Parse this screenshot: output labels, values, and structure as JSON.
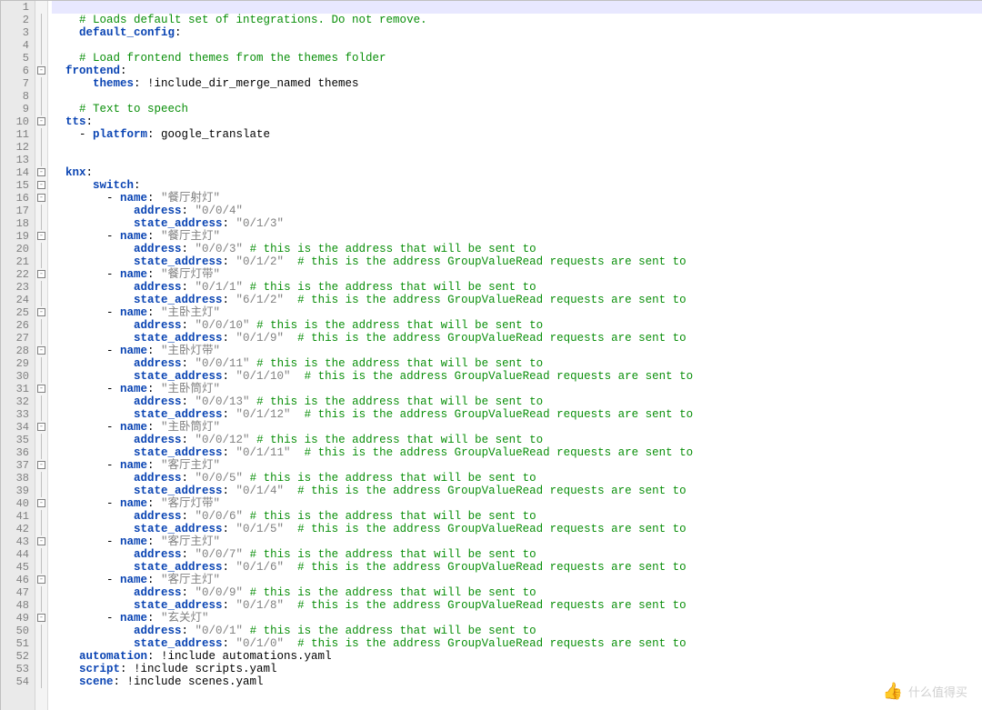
{
  "watermark": "什么值得买",
  "comment_send": "# this is the address that will be sent to",
  "comment_read": "# this is the address GroupValueRead requests are sent to",
  "lines": [
    {
      "n": 1,
      "fold": "",
      "hl": true,
      "parts": []
    },
    {
      "n": 2,
      "fold": "line",
      "parts": [
        {
          "cls": "com",
          "pad": 4,
          "t": "# Loads default set of integrations. Do not remove."
        }
      ]
    },
    {
      "n": 3,
      "fold": "line",
      "parts": [
        {
          "cls": "kw",
          "pad": 4,
          "t": "default_config"
        },
        {
          "cls": "plain",
          "t": ":"
        }
      ]
    },
    {
      "n": 4,
      "fold": "line",
      "parts": []
    },
    {
      "n": 5,
      "fold": "line",
      "parts": [
        {
          "cls": "com",
          "pad": 4,
          "t": "# Load frontend themes from the themes folder"
        }
      ]
    },
    {
      "n": 6,
      "fold": "box",
      "parts": [
        {
          "cls": "kw",
          "pad": 2,
          "t": "frontend"
        },
        {
          "cls": "plain",
          "t": ":"
        }
      ]
    },
    {
      "n": 7,
      "fold": "line",
      "parts": [
        {
          "cls": "kw",
          "pad": 6,
          "t": "themes"
        },
        {
          "cls": "plain",
          "t": ": !include_dir_merge_named themes"
        }
      ]
    },
    {
      "n": 8,
      "fold": "line",
      "parts": []
    },
    {
      "n": 9,
      "fold": "line",
      "parts": [
        {
          "cls": "com",
          "pad": 4,
          "t": "# Text to speech"
        }
      ]
    },
    {
      "n": 10,
      "fold": "box",
      "parts": [
        {
          "cls": "kw",
          "pad": 2,
          "t": "tts"
        },
        {
          "cls": "plain",
          "t": ":"
        }
      ]
    },
    {
      "n": 11,
      "fold": "line",
      "parts": [
        {
          "cls": "plain",
          "pad": 4,
          "t": "- "
        },
        {
          "cls": "kw",
          "t": "platform"
        },
        {
          "cls": "plain",
          "t": ": google_translate"
        }
      ]
    },
    {
      "n": 12,
      "fold": "line",
      "parts": []
    },
    {
      "n": 13,
      "fold": "line",
      "parts": []
    },
    {
      "n": 14,
      "fold": "box",
      "parts": [
        {
          "cls": "kw",
          "pad": 2,
          "t": "knx"
        },
        {
          "cls": "plain",
          "t": ":"
        }
      ]
    },
    {
      "n": 15,
      "fold": "box",
      "parts": [
        {
          "cls": "kw",
          "pad": 6,
          "t": "switch"
        },
        {
          "cls": "plain",
          "t": ":"
        }
      ]
    },
    {
      "n": 16,
      "fold": "box",
      "parts": [
        {
          "cls": "plain",
          "pad": 8,
          "t": "- "
        },
        {
          "cls": "kw",
          "t": "name"
        },
        {
          "cls": "plain",
          "t": ": "
        },
        {
          "cls": "str",
          "t": "\"餐厅射灯\""
        }
      ]
    },
    {
      "n": 17,
      "fold": "line",
      "parts": [
        {
          "cls": "kw",
          "pad": 12,
          "t": "address"
        },
        {
          "cls": "plain",
          "t": ": "
        },
        {
          "cls": "str",
          "t": "\"0/0/4\""
        }
      ]
    },
    {
      "n": 18,
      "fold": "line",
      "parts": [
        {
          "cls": "kw",
          "pad": 12,
          "t": "state_address"
        },
        {
          "cls": "plain",
          "t": ": "
        },
        {
          "cls": "str",
          "t": "\"0/1/3\""
        }
      ]
    },
    {
      "n": 19,
      "fold": "box",
      "parts": [
        {
          "cls": "plain",
          "pad": 8,
          "t": "- "
        },
        {
          "cls": "kw",
          "t": "name"
        },
        {
          "cls": "plain",
          "t": ": "
        },
        {
          "cls": "str",
          "t": "\"餐厅主灯\""
        }
      ]
    },
    {
      "n": 20,
      "fold": "line",
      "parts": [
        {
          "cls": "kw",
          "pad": 12,
          "t": "address"
        },
        {
          "cls": "plain",
          "t": ": "
        },
        {
          "cls": "str",
          "t": "\"0/0/3\""
        },
        {
          "cls": "plain",
          "t": " "
        },
        {
          "cls": "com",
          "ref": "comment_send"
        }
      ]
    },
    {
      "n": 21,
      "fold": "line",
      "parts": [
        {
          "cls": "kw",
          "pad": 12,
          "t": "state_address"
        },
        {
          "cls": "plain",
          "t": ": "
        },
        {
          "cls": "str",
          "t": "\"0/1/2\""
        },
        {
          "cls": "plain",
          "t": "  "
        },
        {
          "cls": "com",
          "ref": "comment_read"
        }
      ]
    },
    {
      "n": 22,
      "fold": "box",
      "parts": [
        {
          "cls": "plain",
          "pad": 8,
          "t": "- "
        },
        {
          "cls": "kw",
          "t": "name"
        },
        {
          "cls": "plain",
          "t": ": "
        },
        {
          "cls": "str",
          "t": "\"餐厅灯带\""
        }
      ]
    },
    {
      "n": 23,
      "fold": "line",
      "parts": [
        {
          "cls": "kw",
          "pad": 12,
          "t": "address"
        },
        {
          "cls": "plain",
          "t": ": "
        },
        {
          "cls": "str",
          "t": "\"0/1/1\""
        },
        {
          "cls": "plain",
          "t": " "
        },
        {
          "cls": "com",
          "ref": "comment_send"
        }
      ]
    },
    {
      "n": 24,
      "fold": "line",
      "parts": [
        {
          "cls": "kw",
          "pad": 12,
          "t": "state_address"
        },
        {
          "cls": "plain",
          "t": ": "
        },
        {
          "cls": "str",
          "t": "\"6/1/2\""
        },
        {
          "cls": "plain",
          "t": "  "
        },
        {
          "cls": "com",
          "ref": "comment_read"
        }
      ]
    },
    {
      "n": 25,
      "fold": "box",
      "parts": [
        {
          "cls": "plain",
          "pad": 8,
          "t": "- "
        },
        {
          "cls": "kw",
          "t": "name"
        },
        {
          "cls": "plain",
          "t": ": "
        },
        {
          "cls": "str",
          "t": "\"主卧主灯\""
        }
      ]
    },
    {
      "n": 26,
      "fold": "line",
      "parts": [
        {
          "cls": "kw",
          "pad": 12,
          "t": "address"
        },
        {
          "cls": "plain",
          "t": ": "
        },
        {
          "cls": "str",
          "t": "\"0/0/10\""
        },
        {
          "cls": "plain",
          "t": " "
        },
        {
          "cls": "com",
          "ref": "comment_send"
        }
      ]
    },
    {
      "n": 27,
      "fold": "line",
      "parts": [
        {
          "cls": "kw",
          "pad": 12,
          "t": "state_address"
        },
        {
          "cls": "plain",
          "t": ": "
        },
        {
          "cls": "str",
          "t": "\"0/1/9\""
        },
        {
          "cls": "plain",
          "t": "  "
        },
        {
          "cls": "com",
          "ref": "comment_read"
        }
      ]
    },
    {
      "n": 28,
      "fold": "box",
      "parts": [
        {
          "cls": "plain",
          "pad": 8,
          "t": "- "
        },
        {
          "cls": "kw",
          "t": "name"
        },
        {
          "cls": "plain",
          "t": ": "
        },
        {
          "cls": "str",
          "t": "\"主卧灯带\""
        }
      ]
    },
    {
      "n": 29,
      "fold": "line",
      "parts": [
        {
          "cls": "kw",
          "pad": 12,
          "t": "address"
        },
        {
          "cls": "plain",
          "t": ": "
        },
        {
          "cls": "str",
          "t": "\"0/0/11\""
        },
        {
          "cls": "plain",
          "t": " "
        },
        {
          "cls": "com",
          "ref": "comment_send"
        }
      ]
    },
    {
      "n": 30,
      "fold": "line",
      "parts": [
        {
          "cls": "kw",
          "pad": 12,
          "t": "state_address"
        },
        {
          "cls": "plain",
          "t": ": "
        },
        {
          "cls": "str",
          "t": "\"0/1/10\""
        },
        {
          "cls": "plain",
          "t": "  "
        },
        {
          "cls": "com",
          "ref": "comment_read"
        }
      ]
    },
    {
      "n": 31,
      "fold": "box",
      "parts": [
        {
          "cls": "plain",
          "pad": 8,
          "t": "- "
        },
        {
          "cls": "kw",
          "t": "name"
        },
        {
          "cls": "plain",
          "t": ": "
        },
        {
          "cls": "str",
          "t": "\"主卧筒灯\""
        }
      ]
    },
    {
      "n": 32,
      "fold": "line",
      "parts": [
        {
          "cls": "kw",
          "pad": 12,
          "t": "address"
        },
        {
          "cls": "plain",
          "t": ": "
        },
        {
          "cls": "str",
          "t": "\"0/0/13\""
        },
        {
          "cls": "plain",
          "t": " "
        },
        {
          "cls": "com",
          "ref": "comment_send"
        }
      ]
    },
    {
      "n": 33,
      "fold": "line",
      "parts": [
        {
          "cls": "kw",
          "pad": 12,
          "t": "state_address"
        },
        {
          "cls": "plain",
          "t": ": "
        },
        {
          "cls": "str",
          "t": "\"0/1/12\""
        },
        {
          "cls": "plain",
          "t": "  "
        },
        {
          "cls": "com",
          "ref": "comment_read"
        }
      ]
    },
    {
      "n": 34,
      "fold": "box",
      "parts": [
        {
          "cls": "plain",
          "pad": 8,
          "t": "- "
        },
        {
          "cls": "kw",
          "t": "name"
        },
        {
          "cls": "plain",
          "t": ": "
        },
        {
          "cls": "str",
          "t": "\"主卧筒灯\""
        }
      ]
    },
    {
      "n": 35,
      "fold": "line",
      "parts": [
        {
          "cls": "kw",
          "pad": 12,
          "t": "address"
        },
        {
          "cls": "plain",
          "t": ": "
        },
        {
          "cls": "str",
          "t": "\"0/0/12\""
        },
        {
          "cls": "plain",
          "t": " "
        },
        {
          "cls": "com",
          "ref": "comment_send"
        }
      ]
    },
    {
      "n": 36,
      "fold": "line",
      "parts": [
        {
          "cls": "kw",
          "pad": 12,
          "t": "state_address"
        },
        {
          "cls": "plain",
          "t": ": "
        },
        {
          "cls": "str",
          "t": "\"0/1/11\""
        },
        {
          "cls": "plain",
          "t": "  "
        },
        {
          "cls": "com",
          "ref": "comment_read"
        }
      ]
    },
    {
      "n": 37,
      "fold": "box",
      "parts": [
        {
          "cls": "plain",
          "pad": 8,
          "t": "- "
        },
        {
          "cls": "kw",
          "t": "name"
        },
        {
          "cls": "plain",
          "t": ": "
        },
        {
          "cls": "str",
          "t": "\"客厅主灯\""
        }
      ]
    },
    {
      "n": 38,
      "fold": "line",
      "parts": [
        {
          "cls": "kw",
          "pad": 12,
          "t": "address"
        },
        {
          "cls": "plain",
          "t": ": "
        },
        {
          "cls": "str",
          "t": "\"0/0/5\""
        },
        {
          "cls": "plain",
          "t": " "
        },
        {
          "cls": "com",
          "ref": "comment_send"
        }
      ]
    },
    {
      "n": 39,
      "fold": "line",
      "parts": [
        {
          "cls": "kw",
          "pad": 12,
          "t": "state_address"
        },
        {
          "cls": "plain",
          "t": ": "
        },
        {
          "cls": "str",
          "t": "\"0/1/4\""
        },
        {
          "cls": "plain",
          "t": "  "
        },
        {
          "cls": "com",
          "ref": "comment_read"
        }
      ]
    },
    {
      "n": 40,
      "fold": "box",
      "parts": [
        {
          "cls": "plain",
          "pad": 8,
          "t": "- "
        },
        {
          "cls": "kw",
          "t": "name"
        },
        {
          "cls": "plain",
          "t": ": "
        },
        {
          "cls": "str",
          "t": "\"客厅灯带\""
        }
      ]
    },
    {
      "n": 41,
      "fold": "line",
      "parts": [
        {
          "cls": "kw",
          "pad": 12,
          "t": "address"
        },
        {
          "cls": "plain",
          "t": ": "
        },
        {
          "cls": "str",
          "t": "\"0/0/6\""
        },
        {
          "cls": "plain",
          "t": " "
        },
        {
          "cls": "com",
          "ref": "comment_send"
        }
      ]
    },
    {
      "n": 42,
      "fold": "line",
      "parts": [
        {
          "cls": "kw",
          "pad": 12,
          "t": "state_address"
        },
        {
          "cls": "plain",
          "t": ": "
        },
        {
          "cls": "str",
          "t": "\"0/1/5\""
        },
        {
          "cls": "plain",
          "t": "  "
        },
        {
          "cls": "com",
          "ref": "comment_read"
        }
      ]
    },
    {
      "n": 43,
      "fold": "box",
      "parts": [
        {
          "cls": "plain",
          "pad": 8,
          "t": "- "
        },
        {
          "cls": "kw",
          "t": "name"
        },
        {
          "cls": "plain",
          "t": ": "
        },
        {
          "cls": "str",
          "t": "\"客厅主灯\""
        }
      ]
    },
    {
      "n": 44,
      "fold": "line",
      "parts": [
        {
          "cls": "kw",
          "pad": 12,
          "t": "address"
        },
        {
          "cls": "plain",
          "t": ": "
        },
        {
          "cls": "str",
          "t": "\"0/0/7\""
        },
        {
          "cls": "plain",
          "t": " "
        },
        {
          "cls": "com",
          "ref": "comment_send"
        }
      ]
    },
    {
      "n": 45,
      "fold": "line",
      "parts": [
        {
          "cls": "kw",
          "pad": 12,
          "t": "state_address"
        },
        {
          "cls": "plain",
          "t": ": "
        },
        {
          "cls": "str",
          "t": "\"0/1/6\""
        },
        {
          "cls": "plain",
          "t": "  "
        },
        {
          "cls": "com",
          "ref": "comment_read"
        }
      ]
    },
    {
      "n": 46,
      "fold": "box",
      "parts": [
        {
          "cls": "plain",
          "pad": 8,
          "t": "- "
        },
        {
          "cls": "kw",
          "t": "name"
        },
        {
          "cls": "plain",
          "t": ": "
        },
        {
          "cls": "str",
          "t": "\"客厅主灯\""
        }
      ]
    },
    {
      "n": 47,
      "fold": "line",
      "parts": [
        {
          "cls": "kw",
          "pad": 12,
          "t": "address"
        },
        {
          "cls": "plain",
          "t": ": "
        },
        {
          "cls": "str",
          "t": "\"0/0/9\""
        },
        {
          "cls": "plain",
          "t": " "
        },
        {
          "cls": "com",
          "ref": "comment_send"
        }
      ]
    },
    {
      "n": 48,
      "fold": "line",
      "parts": [
        {
          "cls": "kw",
          "pad": 12,
          "t": "state_address"
        },
        {
          "cls": "plain",
          "t": ": "
        },
        {
          "cls": "str",
          "t": "\"0/1/8\""
        },
        {
          "cls": "plain",
          "t": "  "
        },
        {
          "cls": "com",
          "ref": "comment_read"
        }
      ]
    },
    {
      "n": 49,
      "fold": "box",
      "parts": [
        {
          "cls": "plain",
          "pad": 8,
          "t": "- "
        },
        {
          "cls": "kw",
          "t": "name"
        },
        {
          "cls": "plain",
          "t": ": "
        },
        {
          "cls": "str",
          "t": "\"玄关灯\""
        }
      ]
    },
    {
      "n": 50,
      "fold": "line",
      "parts": [
        {
          "cls": "kw",
          "pad": 12,
          "t": "address"
        },
        {
          "cls": "plain",
          "t": ": "
        },
        {
          "cls": "str",
          "t": "\"0/0/1\""
        },
        {
          "cls": "plain",
          "t": " "
        },
        {
          "cls": "com",
          "ref": "comment_send"
        }
      ]
    },
    {
      "n": 51,
      "fold": "line",
      "parts": [
        {
          "cls": "kw",
          "pad": 12,
          "t": "state_address"
        },
        {
          "cls": "plain",
          "t": ": "
        },
        {
          "cls": "str",
          "t": "\"0/1/0\""
        },
        {
          "cls": "plain",
          "t": "  "
        },
        {
          "cls": "com",
          "ref": "comment_read"
        }
      ]
    },
    {
      "n": 52,
      "fold": "line",
      "parts": [
        {
          "cls": "kw",
          "pad": 4,
          "t": "automation"
        },
        {
          "cls": "plain",
          "t": ": !include automations.yaml"
        }
      ]
    },
    {
      "n": 53,
      "fold": "line",
      "parts": [
        {
          "cls": "kw",
          "pad": 4,
          "t": "script"
        },
        {
          "cls": "plain",
          "t": ": !include scripts.yaml"
        }
      ]
    },
    {
      "n": 54,
      "fold": "line",
      "parts": [
        {
          "cls": "kw",
          "pad": 4,
          "t": "scene"
        },
        {
          "cls": "plain",
          "t": ": !include scenes.yaml"
        }
      ]
    }
  ]
}
